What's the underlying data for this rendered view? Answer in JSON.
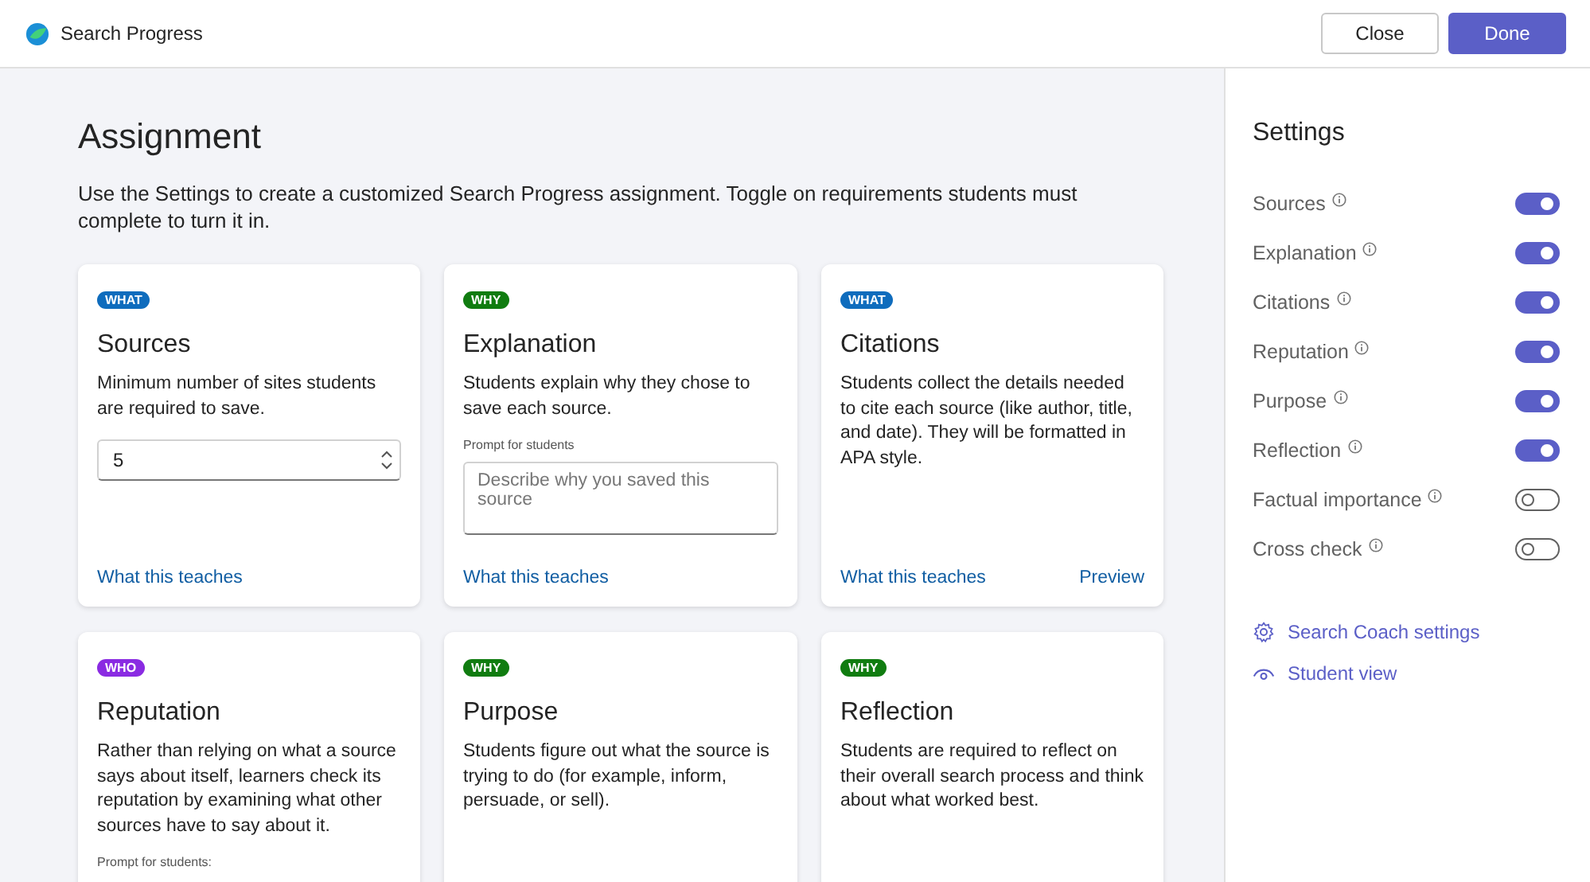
{
  "header": {
    "title": "Search Progress",
    "buttons": [
      {
        "label": "Close",
        "kind": "secondary"
      },
      {
        "label": "Done",
        "kind": "primary"
      }
    ]
  },
  "main": {
    "title": "Assignment",
    "description": "Use the Settings to create a customized Search Progress assignment. Toggle on requirements students must complete to turn it in.",
    "cards": [
      {
        "tag": "WHAT",
        "color": "#0f6cbd",
        "title": "Sources",
        "description": "Minimum number of sites students are required to save.",
        "kind": "number",
        "value": "5",
        "links": [
          "What this teaches"
        ]
      },
      {
        "tag": "WHY",
        "color": "#107c10",
        "title": "Explanation",
        "description": "Students explain why they chose to save each source.",
        "kind": "prompt",
        "prompt_label": "Prompt for students",
        "placeholder": "Describe why you saved this source",
        "links": [
          "What this teaches"
        ]
      },
      {
        "tag": "WHAT",
        "color": "#0f6cbd",
        "title": "Citations",
        "description": "Students collect the details needed to cite each source (like author, title, and date). They will be formatted in APA style.",
        "kind": "plain",
        "links": [
          "What this teaches",
          "Preview"
        ]
      },
      {
        "tag": "WHO",
        "color": "#8a2be2",
        "title": "Reputation",
        "description": "Rather than relying on what a source says about itself, learners check its reputation by examining what other sources have to say about it.",
        "kind": "prompt",
        "prompt_label": "Prompt for students:"
      },
      {
        "tag": "WHY",
        "color": "#107c10",
        "title": "Purpose",
        "description": "Students figure out what the source is trying to do (for example, inform, persuade, or sell).",
        "kind": "plain"
      },
      {
        "tag": "WHY",
        "color": "#107c10",
        "title": "Reflection",
        "description": "Students are required to reflect on their overall search process and think about what worked best.",
        "kind": "plain"
      }
    ]
  },
  "settings": {
    "title": "Settings",
    "toggles": [
      {
        "label": "Sources",
        "on": true
      },
      {
        "label": "Explanation",
        "on": true
      },
      {
        "label": "Citations",
        "on": true
      },
      {
        "label": "Reputation",
        "on": true
      },
      {
        "label": "Purpose",
        "on": true
      },
      {
        "label": "Reflection",
        "on": true
      },
      {
        "label": "Factual importance",
        "on": false
      },
      {
        "label": "Cross check",
        "on": false
      }
    ],
    "links": [
      {
        "label": "Search Coach settings",
        "kind": "gear"
      },
      {
        "label": "Student view",
        "kind": "eye"
      }
    ]
  }
}
